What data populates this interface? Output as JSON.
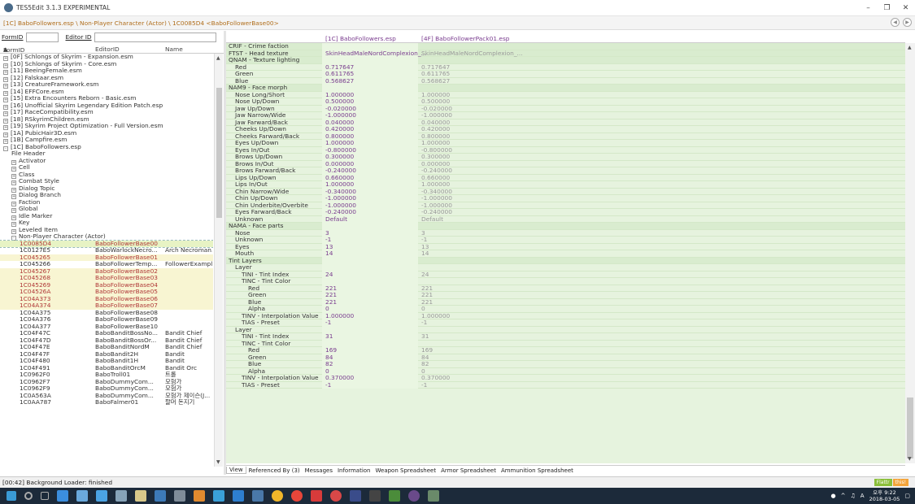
{
  "window": {
    "title": "TES5Edit 3.1.3 EXPERIMENTAL",
    "path": "[1C] BaboFollowers.esp \\ Non-Player Character (Actor) \\ 1C0085D4 <BaboFollowerBase00>"
  },
  "filter": {
    "formid_label": "FormID",
    "editorid_label": "Editor ID"
  },
  "left_header": {
    "formid": "FormID",
    "editorid": "EditorID",
    "name": "Name"
  },
  "tree": [
    {
      "i": 0,
      "e": "+",
      "c1": "[0F] Schlongs of Skyrim - Expansion.esm",
      "c2": "",
      "c3": ""
    },
    {
      "i": 0,
      "e": "+",
      "c1": "[10] Schlongs of Skyrim - Core.esm",
      "c2": "",
      "c3": ""
    },
    {
      "i": 0,
      "e": "+",
      "c1": "[11] BeeingFemale.esm",
      "c2": "",
      "c3": ""
    },
    {
      "i": 0,
      "e": "+",
      "c1": "[12] Falskaar.esm",
      "c2": "",
      "c3": ""
    },
    {
      "i": 0,
      "e": "+",
      "c1": "[13] CreatureFramework.esm",
      "c2": "",
      "c3": ""
    },
    {
      "i": 0,
      "e": "+",
      "c1": "[14] EFFCore.esm",
      "c2": "",
      "c3": ""
    },
    {
      "i": 0,
      "e": "+",
      "c1": "[15] Extra Encounters Reborn - Basic.esm",
      "c2": "",
      "c3": ""
    },
    {
      "i": 0,
      "e": "+",
      "c1": "[16] Unofficial Skyrim Legendary Edition Patch.esp",
      "c2": "",
      "c3": ""
    },
    {
      "i": 0,
      "e": "+",
      "c1": "[17] RaceCompatibility.esm",
      "c2": "",
      "c3": ""
    },
    {
      "i": 0,
      "e": "+",
      "c1": "[18] RSkyrimChildren.esm",
      "c2": "",
      "c3": ""
    },
    {
      "i": 0,
      "e": "+",
      "c1": "[19] Skyrim Project Optimization - Full Version.esm",
      "c2": "",
      "c3": ""
    },
    {
      "i": 0,
      "e": "+",
      "c1": "[1A] PubicHair3D.esm",
      "c2": "",
      "c3": ""
    },
    {
      "i": 0,
      "e": "+",
      "c1": "[1B] Campfire.esm",
      "c2": "",
      "c3": ""
    },
    {
      "i": 0,
      "e": "-",
      "c1": "[1C] BaboFollowers.esp",
      "c2": "",
      "c3": ""
    },
    {
      "i": 1,
      "e": "",
      "c1": "File Header",
      "c2": "",
      "c3": ""
    },
    {
      "i": 1,
      "e": "+",
      "c1": "Activator",
      "c2": "",
      "c3": ""
    },
    {
      "i": 1,
      "e": "+",
      "c1": "Cell",
      "c2": "",
      "c3": ""
    },
    {
      "i": 1,
      "e": "+",
      "c1": "Class",
      "c2": "",
      "c3": ""
    },
    {
      "i": 1,
      "e": "+",
      "c1": "Combat Style",
      "c2": "",
      "c3": ""
    },
    {
      "i": 1,
      "e": "+",
      "c1": "Dialog Topic",
      "c2": "",
      "c3": ""
    },
    {
      "i": 1,
      "e": "+",
      "c1": "Dialog Branch",
      "c2": "",
      "c3": ""
    },
    {
      "i": 1,
      "e": "+",
      "c1": "Faction",
      "c2": "",
      "c3": ""
    },
    {
      "i": 1,
      "e": "+",
      "c1": "Global",
      "c2": "",
      "c3": ""
    },
    {
      "i": 1,
      "e": "+",
      "c1": "Idle Marker",
      "c2": "",
      "c3": ""
    },
    {
      "i": 1,
      "e": "+",
      "c1": "Key",
      "c2": "",
      "c3": ""
    },
    {
      "i": 1,
      "e": "+",
      "c1": "Leveled Item",
      "c2": "",
      "c3": ""
    },
    {
      "i": 1,
      "e": "-",
      "c1": "Non-Player Character (Actor)",
      "c2": "",
      "c3": ""
    },
    {
      "i": 2,
      "e": "",
      "c1": "1C0085D4",
      "c2": "BaboFollowerBase00",
      "c3": "",
      "s": "sel",
      "r": true
    },
    {
      "i": 2,
      "e": "",
      "c1": "1C0127E5",
      "c2": "BaboWarlockNecro...",
      "c3": "Arch Necroman..."
    },
    {
      "i": 2,
      "e": "",
      "c1": "1C045265",
      "c2": "BaboFollowerBase01",
      "c3": "",
      "s": "hl",
      "r": true
    },
    {
      "i": 2,
      "e": "",
      "c1": "1C045266",
      "c2": "BaboFollowerTemp...",
      "c3": "FollowerExample"
    },
    {
      "i": 2,
      "e": "",
      "c1": "1C045267",
      "c2": "BaboFollowerBase02",
      "c3": "",
      "s": "hl",
      "r": true
    },
    {
      "i": 2,
      "e": "",
      "c1": "1C045268",
      "c2": "BaboFollowerBase03",
      "c3": "",
      "s": "hl",
      "r": true
    },
    {
      "i": 2,
      "e": "",
      "c1": "1C045269",
      "c2": "BaboFollowerBase04",
      "c3": "",
      "s": "hl",
      "r": true
    },
    {
      "i": 2,
      "e": "",
      "c1": "1C04526A",
      "c2": "BaboFollowerBase05",
      "c3": "",
      "s": "hl",
      "r": true
    },
    {
      "i": 2,
      "e": "",
      "c1": "1C04A373",
      "c2": "BaboFollowerBase06",
      "c3": "",
      "s": "hl",
      "r": true
    },
    {
      "i": 2,
      "e": "",
      "c1": "1C04A374",
      "c2": "BaboFollowerBase07",
      "c3": "",
      "s": "hl",
      "r": true
    },
    {
      "i": 2,
      "e": "",
      "c1": "1C04A375",
      "c2": "BaboFollowerBase08",
      "c3": ""
    },
    {
      "i": 2,
      "e": "",
      "c1": "1C04A376",
      "c2": "BaboFollowerBase09",
      "c3": ""
    },
    {
      "i": 2,
      "e": "",
      "c1": "1C04A377",
      "c2": "BaboFollowerBase10",
      "c3": ""
    },
    {
      "i": 2,
      "e": "",
      "c1": "1C04F47C",
      "c2": "BaboBanditBossNo...",
      "c3": "Bandit Chief"
    },
    {
      "i": 2,
      "e": "",
      "c1": "1C04F47D",
      "c2": "BaboBanditBossOr...",
      "c3": "Bandit Chief"
    },
    {
      "i": 2,
      "e": "",
      "c1": "1C04F47E",
      "c2": "BaboBanditNordM",
      "c3": "Bandit Chief"
    },
    {
      "i": 2,
      "e": "",
      "c1": "1C04F47F",
      "c2": "BaboBandit2H",
      "c3": "Bandit"
    },
    {
      "i": 2,
      "e": "",
      "c1": "1C04F480",
      "c2": "BaboBandit1H",
      "c3": "Bandit"
    },
    {
      "i": 2,
      "e": "",
      "c1": "1C04F491",
      "c2": "BaboBanditOrcM",
      "c3": "Bandit Orc"
    },
    {
      "i": 2,
      "e": "",
      "c1": "1C0962F0",
      "c2": "BaboTroll01",
      "c3": "트롤"
    },
    {
      "i": 2,
      "e": "",
      "c1": "1C0962F7",
      "c2": "BaboDummyCom...",
      "c3": "모험가"
    },
    {
      "i": 2,
      "e": "",
      "c1": "1C0962F9",
      "c2": "BaboDummyCom...",
      "c3": "모험가"
    },
    {
      "i": 2,
      "e": "",
      "c1": "1C0A563A",
      "c2": "BaboDummyCom...",
      "c3": "모험가 제이슨(J..."
    },
    {
      "i": 2,
      "e": "",
      "c1": "1C0AA787",
      "c2": "BaboFalmer01",
      "c3": "팔머 돈지기"
    }
  ],
  "right_header": {
    "col1": "[1C] BaboFollowers.esp",
    "col2": "[4F] BaboFollowerPack01.esp"
  },
  "record": [
    {
      "t": "sec",
      "l": "CRIF - Crime faction",
      "i": 0,
      "v1": "",
      "v2": ""
    },
    {
      "t": "sec",
      "l": "FTST - Head texture",
      "i": 0,
      "v1": "SkinHeadMaleNordComplexion_...",
      "v2": "SkinHeadMaleNordComplexion_..."
    },
    {
      "t": "sec",
      "l": "QNAM - Texture lighting",
      "i": 0,
      "v1": "",
      "v2": ""
    },
    {
      "l": "Red",
      "i": 1,
      "v1": "0.717647",
      "v2": "0.717647"
    },
    {
      "l": "Green",
      "i": 1,
      "v1": "0.611765",
      "v2": "0.611765"
    },
    {
      "l": "Blue",
      "i": 1,
      "v1": "0.568627",
      "v2": "0.568627"
    },
    {
      "t": "sec",
      "l": "NAM9 - Face morph",
      "i": 0,
      "v1": "",
      "v2": ""
    },
    {
      "l": "Nose Long/Short",
      "i": 1,
      "v1": "1.000000",
      "v2": "1.000000"
    },
    {
      "l": "Nose Up/Down",
      "i": 1,
      "v1": "0.500000",
      "v2": "0.500000"
    },
    {
      "l": "Jaw Up/Down",
      "i": 1,
      "v1": "-0.020000",
      "v2": "-0.020000"
    },
    {
      "l": "Jaw Narrow/Wide",
      "i": 1,
      "v1": "-1.000000",
      "v2": "-1.000000"
    },
    {
      "l": "Jaw Farward/Back",
      "i": 1,
      "v1": "0.040000",
      "v2": "0.040000"
    },
    {
      "l": "Cheeks Up/Down",
      "i": 1,
      "v1": "0.420000",
      "v2": "0.420000"
    },
    {
      "l": "Cheeks Farward/Back",
      "i": 1,
      "v1": "0.800000",
      "v2": "0.800000"
    },
    {
      "l": "Eyes Up/Down",
      "i": 1,
      "v1": "1.000000",
      "v2": "1.000000"
    },
    {
      "l": "Eyes In/Out",
      "i": 1,
      "v1": "-0.800000",
      "v2": "-0.800000"
    },
    {
      "l": "Brows Up/Down",
      "i": 1,
      "v1": "0.300000",
      "v2": "0.300000"
    },
    {
      "l": "Brows In/Out",
      "i": 1,
      "v1": "0.000000",
      "v2": "0.000000"
    },
    {
      "l": "Brows Farward/Back",
      "i": 1,
      "v1": "-0.240000",
      "v2": "-0.240000"
    },
    {
      "l": "Lips Up/Down",
      "i": 1,
      "v1": "0.660000",
      "v2": "0.660000"
    },
    {
      "l": "Lips In/Out",
      "i": 1,
      "v1": "1.000000",
      "v2": "1.000000"
    },
    {
      "l": "Chin Narrow/Wide",
      "i": 1,
      "v1": "-0.340000",
      "v2": "-0.340000"
    },
    {
      "l": "Chin Up/Down",
      "i": 1,
      "v1": "-1.000000",
      "v2": "-1.000000"
    },
    {
      "l": "Chin Underbite/Overbite",
      "i": 1,
      "v1": "-1.000000",
      "v2": "-1.000000"
    },
    {
      "l": "Eyes Farward/Back",
      "i": 1,
      "v1": "-0.240000",
      "v2": "-0.240000"
    },
    {
      "l": "Unknown",
      "i": 1,
      "v1": "Default",
      "v2": "Default"
    },
    {
      "t": "sec",
      "l": "NAMA - Face parts",
      "i": 0,
      "v1": "",
      "v2": ""
    },
    {
      "l": "Nose",
      "i": 1,
      "v1": "3",
      "v2": "3"
    },
    {
      "l": "Unknown",
      "i": 1,
      "v1": "-1",
      "v2": "-1"
    },
    {
      "l": "Eyes",
      "i": 1,
      "v1": "13",
      "v2": "13"
    },
    {
      "l": "Mouth",
      "i": 1,
      "v1": "14",
      "v2": "14"
    },
    {
      "t": "sec",
      "l": "Tint Layers",
      "i": 0,
      "v1": "",
      "v2": ""
    },
    {
      "l": "Layer",
      "i": 1,
      "v1": "",
      "v2": ""
    },
    {
      "l": "TINI - Tint Index",
      "i": 2,
      "v1": "24",
      "v2": "24"
    },
    {
      "l": "TINC - Tint Color",
      "i": 2,
      "v1": "",
      "v2": ""
    },
    {
      "l": "Red",
      "i": 3,
      "v1": "221",
      "v2": "221"
    },
    {
      "l": "Green",
      "i": 3,
      "v1": "221",
      "v2": "221"
    },
    {
      "l": "Blue",
      "i": 3,
      "v1": "221",
      "v2": "221"
    },
    {
      "l": "Alpha",
      "i": 3,
      "v1": "0",
      "v2": "0"
    },
    {
      "l": "TINV - Interpolation Value",
      "i": 2,
      "v1": "1.000000",
      "v2": "1.000000"
    },
    {
      "l": "TIAS - Preset",
      "i": 2,
      "v1": "-1",
      "v2": "-1"
    },
    {
      "l": "Layer",
      "i": 1,
      "v1": "",
      "v2": ""
    },
    {
      "l": "TINI - Tint Index",
      "i": 2,
      "v1": "31",
      "v2": "31"
    },
    {
      "l": "TINC - Tint Color",
      "i": 2,
      "v1": "",
      "v2": ""
    },
    {
      "l": "Red",
      "i": 3,
      "v1": "169",
      "v2": "169"
    },
    {
      "l": "Green",
      "i": 3,
      "v1": "84",
      "v2": "84"
    },
    {
      "l": "Blue",
      "i": 3,
      "v1": "82",
      "v2": "82"
    },
    {
      "l": "Alpha",
      "i": 3,
      "v1": "0",
      "v2": "0"
    },
    {
      "l": "TINV - Interpolation Value",
      "i": 2,
      "v1": "0.370000",
      "v2": "0.370000"
    },
    {
      "l": "TIAS - Preset",
      "i": 2,
      "v1": "-1",
      "v2": "-1"
    }
  ],
  "tabs": [
    "View",
    "Referenced By (3)",
    "Messages",
    "Information",
    "Weapon Spreadsheet",
    "Armor Spreadsheet",
    "Ammunition Spreadsheet"
  ],
  "status": {
    "text": "[00:42] Background Loader: finished",
    "flattr_label": "Flattr",
    "flattr_this": "this!"
  },
  "taskbar": {
    "time": "오후 9:22",
    "date": "2018-03-05",
    "ime": "A",
    "volume_icon": "speaker-icon"
  },
  "colors": {
    "accent_green": "#e6f3de",
    "record_value": "#7a3d8f",
    "tree_red": "#b03838",
    "highlight_yellow": "#f8f5d2"
  }
}
